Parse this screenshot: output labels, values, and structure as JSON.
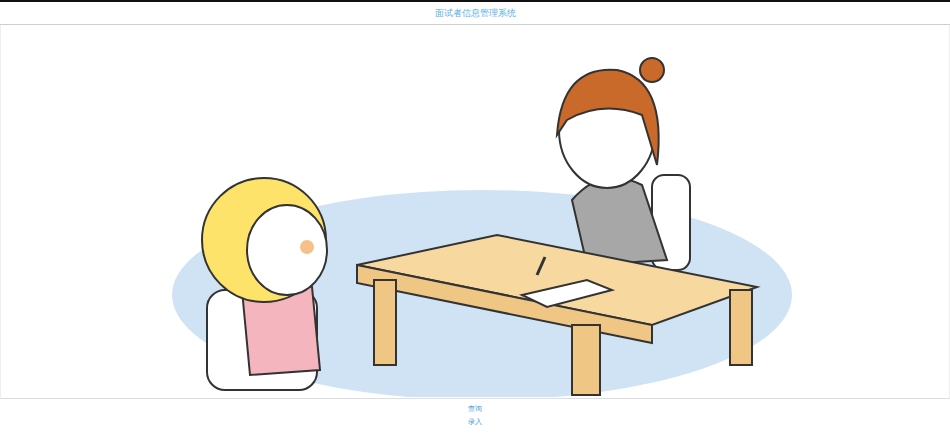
{
  "header": {
    "title": "面试者信息管理系统"
  },
  "links": [
    {
      "label": "查询"
    },
    {
      "label": "录入"
    }
  ]
}
